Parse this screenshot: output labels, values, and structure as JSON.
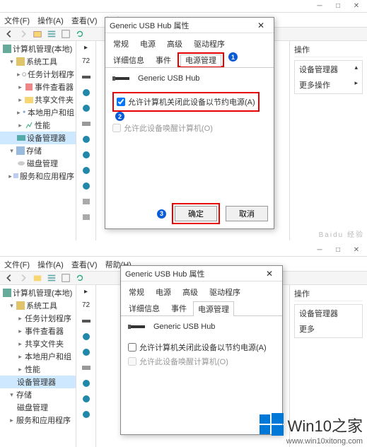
{
  "menu": {
    "file": "文件(F)",
    "action": "操作(A)",
    "view": "查看(V)",
    "help": "帮助(H)"
  },
  "tree": {
    "root": "计算机管理(本地)",
    "systools": "系统工具",
    "task": "任务计划程序",
    "event": "事件查看器",
    "shared": "共享文件夹",
    "users": "本地用户和组",
    "perf": "性能",
    "devmgr": "设备管理器",
    "storage": "存储",
    "disk": "磁盘管理",
    "svc": "服务和应用程序"
  },
  "stripLabel": "72",
  "dialog": {
    "title": "Generic USB Hub 属性",
    "tabs": {
      "general": "常规",
      "power": "电源",
      "advanced": "高级",
      "driver": "驱动程序",
      "details": "详细信息",
      "events": "事件",
      "powermgmt": "电源管理"
    },
    "device": "Generic USB Hub",
    "opt1": "允许计算机关闭此设备以节约电源(A)",
    "opt2": "允许此设备唤醒计算机(O)",
    "ok": "确定",
    "cancel": "取消"
  },
  "annots": {
    "one": "1",
    "two": "2",
    "three": "3"
  },
  "rightPane": {
    "header": "操作",
    "line1": "设备管理器",
    "line2": "更多操作",
    "line2b": "更多"
  },
  "titlebarText": "",
  "watermark": {
    "brand": "Win10之家",
    "url": "www.win10xitong.com"
  },
  "baidu": "Baidu 经验"
}
